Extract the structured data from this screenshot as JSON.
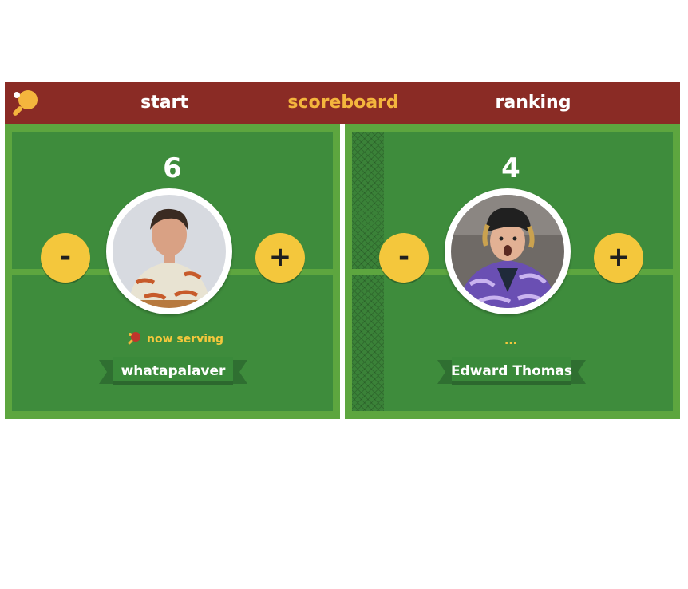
{
  "nav": {
    "logo_icon": "ping-pong-paddle-icon",
    "items": [
      {
        "label": "start",
        "active": false
      },
      {
        "label": "scoreboard",
        "active": true
      },
      {
        "label": "ranking",
        "active": false
      }
    ]
  },
  "players": [
    {
      "score": "6",
      "name": "whatapalaver",
      "status": "now serving",
      "status_icon": "ping-pong-paddle-icon",
      "minus_label": "-",
      "plus_label": "+"
    },
    {
      "score": "4",
      "name": "Edward Thomas",
      "status": "...",
      "minus_label": "-",
      "plus_label": "+"
    }
  ],
  "colors": {
    "header": "#8a2b25",
    "active_nav": "#f4b53d",
    "court_border": "#5da63f",
    "court": "#3e8c3c",
    "button": "#f4c73c",
    "banner": "#2f6f31"
  }
}
